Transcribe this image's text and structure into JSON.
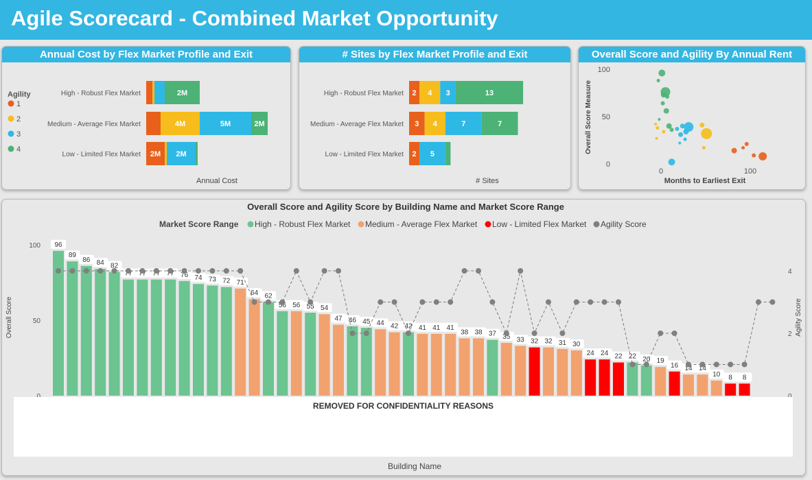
{
  "header": {
    "title": "Agile Scorecard - Combined Market Opportunity"
  },
  "colors": {
    "accent": "#33b6e2",
    "agility_1": "#e8601c",
    "agility_2": "#f6bd1d",
    "agility_3": "#2eb8e6",
    "agility_4": "#4cb276",
    "high": "#6cc490",
    "medium": "#f2a26f",
    "low": "#ff0000",
    "agility_score": "#808080"
  },
  "panel1": {
    "title": "Annual Cost by Flex Market Profile and Exit",
    "legend_title": "Agility",
    "legend_items": [
      "1",
      "2",
      "3",
      "4"
    ],
    "xlabel": "Annual Cost"
  },
  "panel2": {
    "title": "# Sites by Flex Market Profile and Exit",
    "xlabel": "# Sites"
  },
  "panel3": {
    "title": "Overall Score and Agility By Annual Rent",
    "xlabel": "Months to Earliest Exit",
    "ylabel": "Overall Score Measure"
  },
  "panel4": {
    "title": "Overall Score and Agility Score by Building Name and Market Score Range",
    "legend_title": "Market Score Range",
    "legend_items": [
      "High - Robust Flex Market",
      "Medium - Average Flex Market",
      "Low - Limited Flex Market",
      "Agility Score"
    ],
    "ylabel_left": "Overall Score",
    "ylabel_right": "Agility Score",
    "xlabel": "Building Name",
    "removed_text": "REMOVED FOR CONFIDENTIALITY REASONS"
  },
  "chart_data": [
    {
      "type": "bar",
      "orientation": "horizontal",
      "stacked": true,
      "title": "Annual Cost by Flex Market Profile and Exit",
      "xlabel": "Annual Cost",
      "categories": [
        "High - Robust Flex Market",
        "Medium - Average Flex Market",
        "Low - Limited Flex Market"
      ],
      "series": [
        {
          "name": "1",
          "values": [
            0.3,
            0.7,
            0.9
          ],
          "labels": [
            "",
            "",
            "2M"
          ]
        },
        {
          "name": "2",
          "values": [
            0.1,
            1.9,
            0.1
          ],
          "labels": [
            "",
            "4M",
            ""
          ]
        },
        {
          "name": "3",
          "values": [
            0.5,
            2.5,
            1.4
          ],
          "labels": [
            "",
            "5M",
            "2M"
          ]
        },
        {
          "name": "4",
          "values": [
            1.7,
            0.8,
            0.1
          ],
          "labels": [
            "2M",
            "2M",
            ""
          ]
        }
      ],
      "xlim": [
        0,
        6.5
      ],
      "legend": "left"
    },
    {
      "type": "bar",
      "orientation": "horizontal",
      "stacked": true,
      "title": "# Sites by Flex Market Profile and Exit",
      "xlabel": "# Sites",
      "categories": [
        "High - Robust Flex Market",
        "Medium - Average Flex Market",
        "Low - Limited Flex Market"
      ],
      "series": [
        {
          "name": "1",
          "values": [
            2,
            3,
            2
          ]
        },
        {
          "name": "2",
          "values": [
            4,
            4,
            0
          ]
        },
        {
          "name": "3",
          "values": [
            3,
            7,
            5
          ]
        },
        {
          "name": "4",
          "values": [
            13,
            7,
            1
          ]
        }
      ],
      "xlim": [
        0,
        32
      ]
    },
    {
      "type": "scatter",
      "title": "Overall Score and Agility By Annual Rent",
      "xlabel": "Months to Earliest Exit",
      "ylabel": "Overall Score Measure",
      "xticks": [
        0,
        100
      ],
      "yticks": [
        0,
        50,
        100
      ],
      "xlim": [
        -20,
        130
      ],
      "ylim": [
        0,
        100
      ],
      "points": [
        {
          "x": 1,
          "y": 96,
          "agility": 4,
          "size": 5
        },
        {
          "x": -3,
          "y": 88,
          "agility": 4,
          "size": 2.5
        },
        {
          "x": 5,
          "y": 76,
          "agility": 4,
          "size": 7
        },
        {
          "x": 3,
          "y": 73,
          "agility": 4,
          "size": 4
        },
        {
          "x": 7,
          "y": 71,
          "agility": 4,
          "size": 3
        },
        {
          "x": 2,
          "y": 64,
          "agility": 4,
          "size": 3
        },
        {
          "x": 6,
          "y": 56,
          "agility": 4,
          "size": 4
        },
        {
          "x": -2,
          "y": 47,
          "agility": 4,
          "size": 2
        },
        {
          "x": 9,
          "y": 40,
          "agility": 4,
          "size": 4
        },
        {
          "x": 12,
          "y": 36,
          "agility": 4,
          "size": 3
        },
        {
          "x": 18,
          "y": 37,
          "agility": 3,
          "size": 3
        },
        {
          "x": 24,
          "y": 40,
          "agility": 3,
          "size": 3.5
        },
        {
          "x": 31,
          "y": 39,
          "agility": 3,
          "size": 7
        },
        {
          "x": 28,
          "y": 34,
          "agility": 3,
          "size": 4
        },
        {
          "x": 22,
          "y": 31,
          "agility": 3,
          "size": 3.5
        },
        {
          "x": 27,
          "y": 26,
          "agility": 3,
          "size": 2.5
        },
        {
          "x": 21,
          "y": 22,
          "agility": 3,
          "size": 2
        },
        {
          "x": 12,
          "y": 2,
          "agility": 3,
          "size": 5
        },
        {
          "x": -6,
          "y": 42,
          "agility": 2,
          "size": 2
        },
        {
          "x": -4,
          "y": 38,
          "agility": 2,
          "size": 2.5
        },
        {
          "x": 3,
          "y": 34,
          "agility": 2,
          "size": 2.5
        },
        {
          "x": 46,
          "y": 41,
          "agility": 2,
          "size": 3.5
        },
        {
          "x": 51,
          "y": 32,
          "agility": 2,
          "size": 8
        },
        {
          "x": 48,
          "y": 17,
          "agility": 2,
          "size": 2.5
        },
        {
          "x": -5,
          "y": 27,
          "agility": 2,
          "size": 2
        },
        {
          "x": 82,
          "y": 14,
          "agility": 1,
          "size": 4
        },
        {
          "x": 96,
          "y": 21,
          "agility": 1,
          "size": 3
        },
        {
          "x": 92,
          "y": 17,
          "agility": 1,
          "size": 2.5
        },
        {
          "x": 114,
          "y": 8,
          "agility": 1,
          "size": 6
        },
        {
          "x": 104,
          "y": 9,
          "agility": 1,
          "size": 3
        }
      ]
    },
    {
      "type": "bar",
      "title": "Overall Score and Agility Score by Building Name and Market Score Range",
      "ylabel": "Overall Score",
      "y2label": "Agility Score",
      "xlabel": "Building Name",
      "ylim": [
        0,
        100
      ],
      "y2lim": [
        0,
        4
      ],
      "yticks": [
        0,
        50,
        100
      ],
      "y2ticks": [
        0,
        2,
        4
      ],
      "legend": "top",
      "bars": [
        {
          "value": 96,
          "range": "High - Robust Flex Market",
          "agility": 4
        },
        {
          "value": 89,
          "range": "High - Robust Flex Market",
          "agility": 4
        },
        {
          "value": 86,
          "range": "High - Robust Flex Market",
          "agility": 4
        },
        {
          "value": 84,
          "range": "High - Robust Flex Market",
          "agility": 4
        },
        {
          "value": 82,
          "range": "High - Robust Flex Market",
          "agility": 4
        },
        {
          "value": 77,
          "range": "High - Robust Flex Market",
          "agility": 4
        },
        {
          "value": 77,
          "range": "High - Robust Flex Market",
          "agility": 4
        },
        {
          "value": 77,
          "range": "High - Robust Flex Market",
          "agility": 4
        },
        {
          "value": 77,
          "range": "High - Robust Flex Market",
          "agility": 4
        },
        {
          "value": 76,
          "range": "High - Robust Flex Market",
          "agility": 4
        },
        {
          "value": 74,
          "range": "High - Robust Flex Market",
          "agility": 4
        },
        {
          "value": 73,
          "range": "High - Robust Flex Market",
          "agility": 4
        },
        {
          "value": 72,
          "range": "High - Robust Flex Market",
          "agility": 4
        },
        {
          "value": 71,
          "range": "Medium - Average Flex Market",
          "agility": 4
        },
        {
          "value": 64,
          "range": "Medium - Average Flex Market",
          "agility": 3
        },
        {
          "value": 62,
          "range": "High - Robust Flex Market",
          "agility": 3
        },
        {
          "value": 56,
          "range": "High - Robust Flex Market",
          "agility": 3
        },
        {
          "value": 56,
          "range": "Medium - Average Flex Market",
          "agility": 4
        },
        {
          "value": 55,
          "range": "High - Robust Flex Market",
          "agility": 3
        },
        {
          "value": 54,
          "range": "Medium - Average Flex Market",
          "agility": 4
        },
        {
          "value": 47,
          "range": "Medium - Average Flex Market",
          "agility": 4
        },
        {
          "value": 46,
          "range": "High - Robust Flex Market",
          "agility": 2
        },
        {
          "value": 45,
          "range": "High - Robust Flex Market",
          "agility": 2
        },
        {
          "value": 44,
          "range": "Medium - Average Flex Market",
          "agility": 3
        },
        {
          "value": 42,
          "range": "Medium - Average Flex Market",
          "agility": 3
        },
        {
          "value": 42,
          "range": "High - Robust Flex Market",
          "agility": 2
        },
        {
          "value": 41,
          "range": "Medium - Average Flex Market",
          "agility": 3
        },
        {
          "value": 41,
          "range": "Medium - Average Flex Market",
          "agility": 3
        },
        {
          "value": 41,
          "range": "Medium - Average Flex Market",
          "agility": 3
        },
        {
          "value": 38,
          "range": "Medium - Average Flex Market",
          "agility": 4
        },
        {
          "value": 38,
          "range": "Medium - Average Flex Market",
          "agility": 4
        },
        {
          "value": 37,
          "range": "High - Robust Flex Market",
          "agility": 3
        },
        {
          "value": 35,
          "range": "Medium - Average Flex Market",
          "agility": 2
        },
        {
          "value": 33,
          "range": "Medium - Average Flex Market",
          "agility": 4
        },
        {
          "value": 32,
          "range": "Low - Limited Flex Market",
          "agility": 2
        },
        {
          "value": 32,
          "range": "Medium - Average Flex Market",
          "agility": 3
        },
        {
          "value": 31,
          "range": "Medium - Average Flex Market",
          "agility": 2
        },
        {
          "value": 30,
          "range": "Medium - Average Flex Market",
          "agility": 3
        },
        {
          "value": 24,
          "range": "Low - Limited Flex Market",
          "agility": 3
        },
        {
          "value": 24,
          "range": "Low - Limited Flex Market",
          "agility": 3
        },
        {
          "value": 22,
          "range": "Low - Limited Flex Market",
          "agility": 3
        },
        {
          "value": 22,
          "range": "High - Robust Flex Market",
          "agility": 1
        },
        {
          "value": 20,
          "range": "High - Robust Flex Market",
          "agility": 1
        },
        {
          "value": 19,
          "range": "Medium - Average Flex Market",
          "agility": 2
        },
        {
          "value": 16,
          "range": "Low - Limited Flex Market",
          "agility": 2
        },
        {
          "value": 14,
          "range": "Medium - Average Flex Market",
          "agility": 1
        },
        {
          "value": 14,
          "range": "Medium - Average Flex Market",
          "agility": 1
        },
        {
          "value": 10,
          "range": "Medium - Average Flex Market",
          "agility": 1
        },
        {
          "value": 8,
          "range": "Low - Limited Flex Market",
          "agility": 1
        },
        {
          "value": 8,
          "range": "Low - Limited Flex Market",
          "agility": 1
        },
        {
          "value": null,
          "range": "",
          "agility": 3
        },
        {
          "value": null,
          "range": "",
          "agility": 3
        }
      ]
    }
  ]
}
